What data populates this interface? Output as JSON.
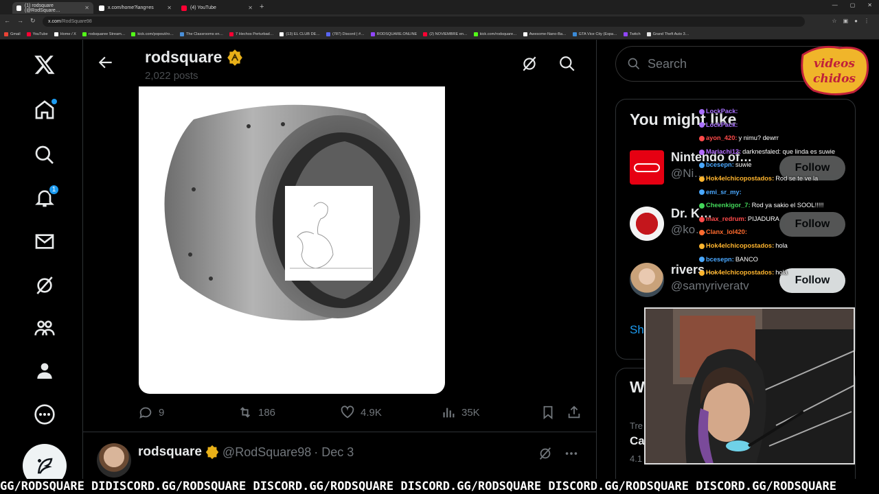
{
  "browser": {
    "tabs": [
      {
        "label": "(1) rodsquare (@RodSquare…",
        "active": true
      },
      {
        "label": "x.com/home?lang=es",
        "active": false
      },
      {
        "label": "(4) YouTube",
        "active": false
      }
    ],
    "url_host": "x.com",
    "url_path": "/RodSquare98",
    "bookmarks": [
      "Gmail",
      "YouTube",
      "Home / X",
      "rodsquaree Stream…",
      "kick.com/popout/ro…",
      "The Classrooms en…",
      "7 Hechos Perturbad…",
      "(13) EL CLUB DE…",
      "(787) Discord | #…",
      "RODSQUARE.ONLINE",
      "(2) NOVIEMBRE en…",
      "kick.com/rodsquare…",
      "Awesome-Nano-Ba…",
      "GTA Vice City (Espa…",
      "Twitch",
      "Grand Theft Auto 3…"
    ]
  },
  "nav": {
    "notifications_badge": "1"
  },
  "profile_header": {
    "name": "rodsquare",
    "post_count": "2,022 posts"
  },
  "post": {
    "replies": "9",
    "reposts": "186",
    "likes": "4.9K",
    "views": "35K"
  },
  "next_post": {
    "name": "rodsquare",
    "handle": "@RodSquare98",
    "date": "· Dec 3"
  },
  "sidebar": {
    "search_placeholder": "Search",
    "who_to_follow_title": "You might like",
    "suggestions": [
      {
        "name": "Nintendo of…",
        "handle": "@Ni…",
        "button": "Follow"
      },
      {
        "name": "Dr. K…",
        "handle": "@ko…",
        "button": "Follow"
      },
      {
        "name": "rivers…",
        "handle": "@samyriveratv",
        "button": "Follow"
      }
    ],
    "show_more": "Sh",
    "whats_title": "W",
    "trend_sub": "Tre",
    "trend_name": "Ca",
    "trend_count": "4.1"
  },
  "stream": {
    "logo_text": "videos chidos",
    "chat": [
      {
        "user": "LockPack:",
        "msg": "",
        "color": "#a970ff"
      },
      {
        "user": "LockPack:",
        "msg": "",
        "color": "#a970ff"
      },
      {
        "user": "ayon_420:",
        "msg": "y nimu? dewrr",
        "color": "#ff4a4a"
      },
      {
        "user": "Mariachi12:",
        "msg": "darknesfaled: que linda es suwie",
        "color": "#b36bff"
      },
      {
        "user": "bcesepn:",
        "msg": "suwie",
        "color": "#4aa8ff"
      },
      {
        "user": "Hok4elchicopostados:",
        "msg": "Rod se te ve la",
        "color": "#ffb52e"
      },
      {
        "user": "emi_sr_my:",
        "msg": "",
        "color": "#4aa8ff"
      },
      {
        "user": "Cheenkigor_7:",
        "msg": "Rod ya sakio el SOOL!!!!!",
        "color": "#43d65a"
      },
      {
        "user": "max_redrum:",
        "msg": "PIJADURA",
        "color": "#ff4a4a"
      },
      {
        "user": "Clanx_lol420:",
        "msg": "",
        "color": "#ff6b2e"
      },
      {
        "user": "Hok4elchicopostados:",
        "msg": "hola",
        "color": "#ffb52e"
      },
      {
        "user": "bcesepn:",
        "msg": "BANCO",
        "color": "#4aa8ff"
      },
      {
        "user": "Hok4elchicopostados:",
        "msg": "hola",
        "color": "#ffb52e"
      }
    ],
    "ticker": "GG/RODSQUARE DIDISCORD.GG/RODSQUARE DISCORD.GG/RODSQUARE DISCORD.GG/RODSQUARE DISCORD.GG/RODSQUARE DISCORD.GG/RODSQUARE"
  }
}
